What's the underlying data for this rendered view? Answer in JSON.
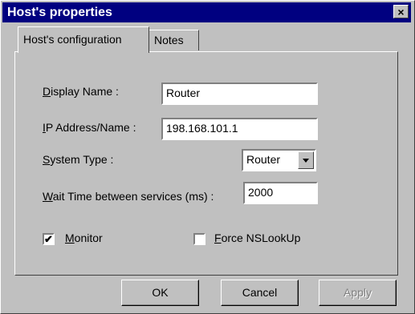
{
  "window": {
    "title": "Host's properties",
    "close_label": "×"
  },
  "tabs": [
    {
      "label": "Host's configuration",
      "active": true
    },
    {
      "label": "Notes",
      "active": false
    }
  ],
  "form": {
    "display_name": {
      "label_prefix": "",
      "label_key": "D",
      "label_rest": "isplay Name :",
      "value": "Router"
    },
    "ip_address": {
      "label_prefix": "",
      "label_key": "I",
      "label_rest": "P Address/Name :",
      "value": "198.168.101.1"
    },
    "system_type": {
      "label_prefix": "",
      "label_key": "S",
      "label_rest": "ystem Type :",
      "value": "Router"
    },
    "wait_time": {
      "label_prefix": "",
      "label_key": "W",
      "label_rest": "ait Time between services (ms) :",
      "value": "2000"
    },
    "monitor": {
      "label_key": "M",
      "label_rest": "onitor",
      "checked": true,
      "mark": "✔"
    },
    "force_nslookup": {
      "label_key": "F",
      "label_rest": "orce NSLookUp",
      "checked": false
    }
  },
  "buttons": {
    "ok": "OK",
    "cancel": "Cancel",
    "apply": "Apply"
  }
}
